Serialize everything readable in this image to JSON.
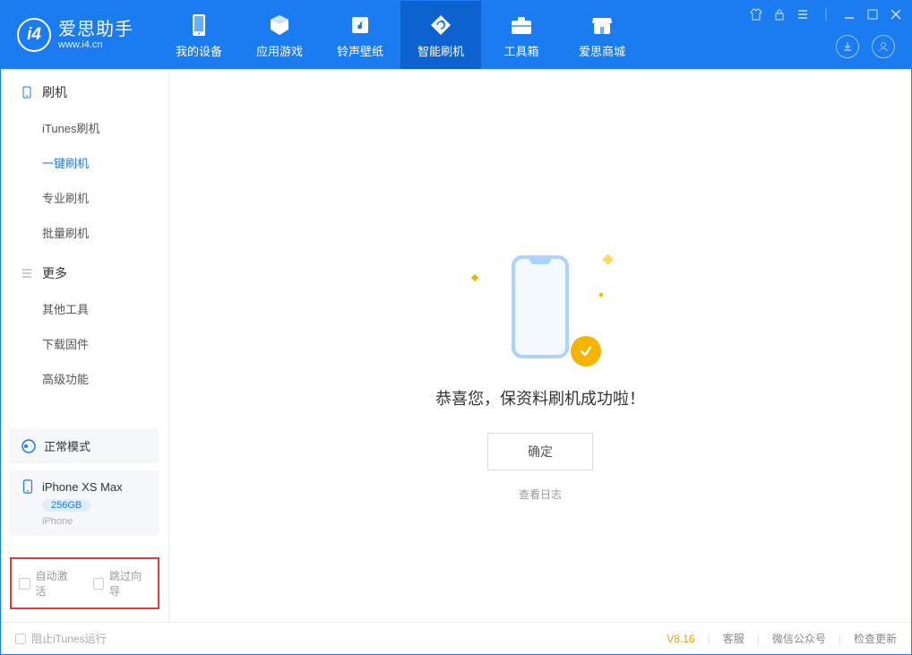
{
  "app": {
    "name": "爱思助手",
    "url": "www.i4.cn"
  },
  "nav": {
    "items": [
      {
        "label": "我的设备",
        "icon": "device-icon"
      },
      {
        "label": "应用游戏",
        "icon": "cube-icon"
      },
      {
        "label": "铃声壁纸",
        "icon": "music-icon"
      },
      {
        "label": "智能刷机",
        "icon": "refresh-icon"
      },
      {
        "label": "工具箱",
        "icon": "briefcase-icon"
      },
      {
        "label": "爱思商城",
        "icon": "shop-icon"
      }
    ],
    "active_index": 3
  },
  "sidebar": {
    "sections": [
      {
        "title": "刷机",
        "items": [
          "iTunes刷机",
          "一键刷机",
          "专业刷机",
          "批量刷机"
        ],
        "active_index": 1
      },
      {
        "title": "更多",
        "items": [
          "其他工具",
          "下载固件",
          "高级功能"
        ],
        "active_index": -1
      }
    ],
    "mode_card": {
      "label": "正常模式"
    },
    "device_card": {
      "name": "iPhone XS Max",
      "capacity": "256GB",
      "kind": "iPhone"
    },
    "checks": {
      "auto_activate": "自动激活",
      "skip_guide": "跳过向导"
    }
  },
  "main": {
    "success_message": "恭喜您，保资料刷机成功啦！",
    "ok_label": "确定",
    "view_log": "查看日志"
  },
  "footer": {
    "block_itunes": "阻止iTunes运行",
    "version": "V8.16",
    "links": [
      "客服",
      "微信公众号",
      "检查更新"
    ]
  }
}
